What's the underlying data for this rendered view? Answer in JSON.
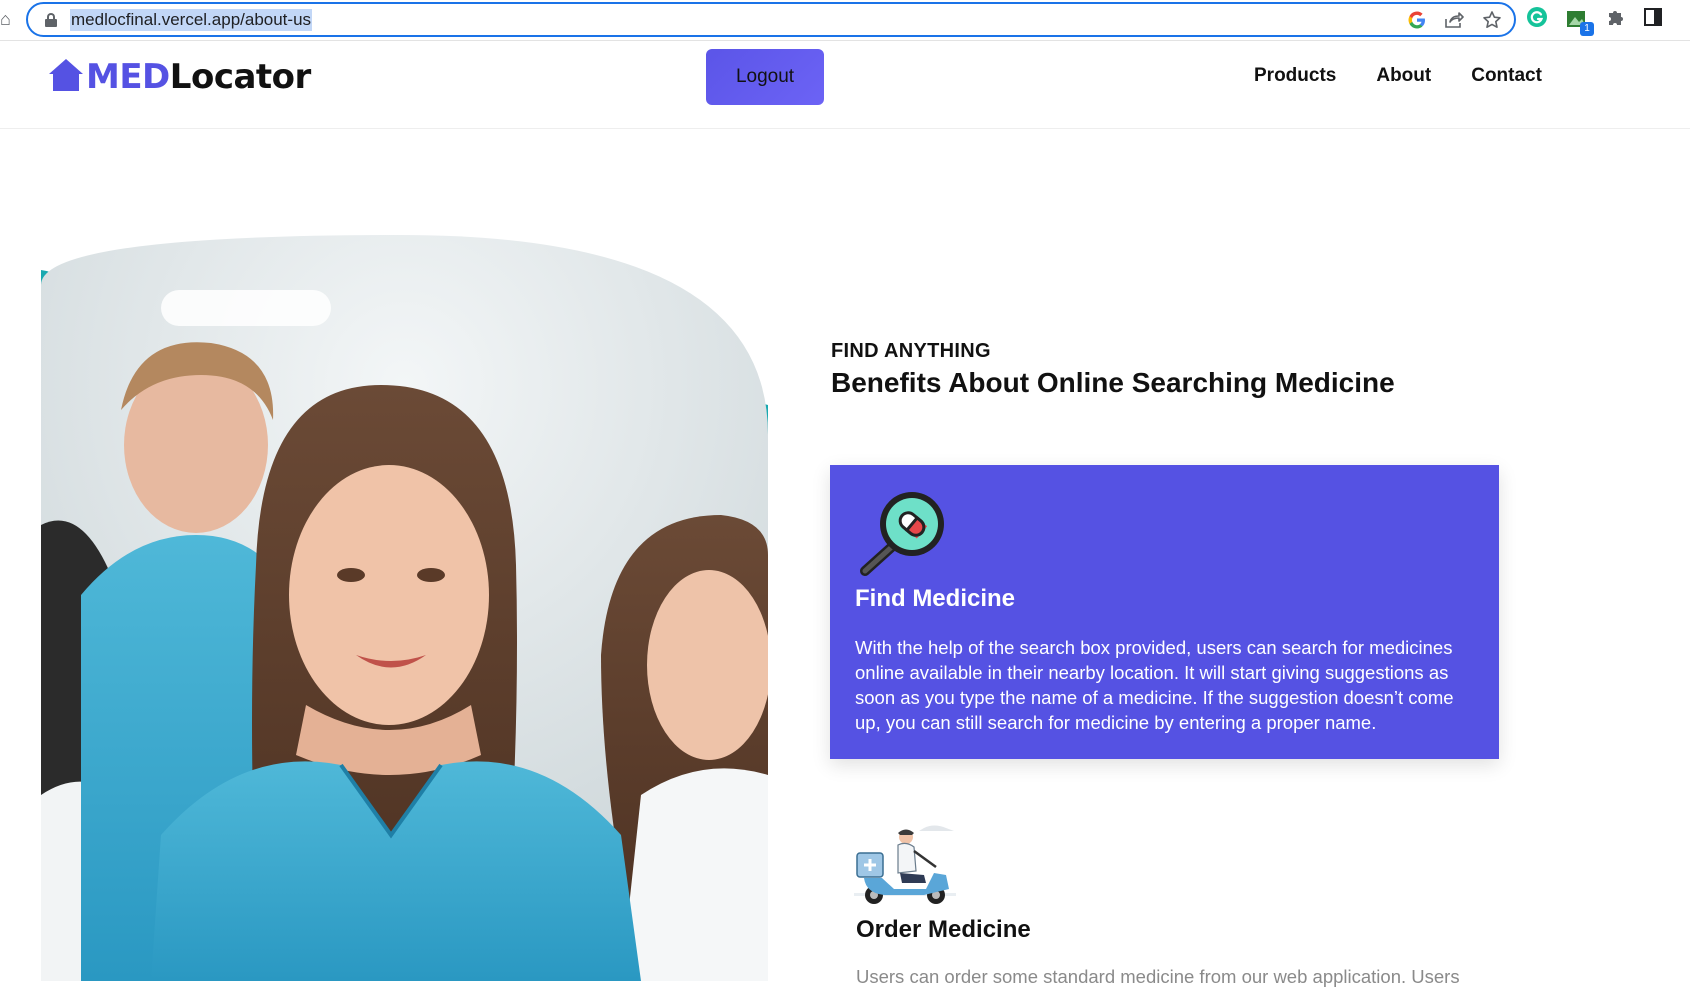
{
  "browser": {
    "url": "medlocfinal.vercel.app/about-us",
    "icons": [
      "home-icon",
      "lock-icon",
      "google-icon",
      "share-icon",
      "star-icon",
      "grammarly-icon",
      "extension-badge-icon",
      "puzzle-icon",
      "side-panel-icon"
    ],
    "extension_badge_count": "1"
  },
  "header": {
    "logo_prefix": "MED",
    "logo_suffix": "Locator",
    "logout_label": "Logout",
    "nav": [
      {
        "label": "Products"
      },
      {
        "label": "About"
      },
      {
        "label": "Contact"
      }
    ]
  },
  "main": {
    "eyebrow": "FIND ANYTHING",
    "title": "Benefits About Online Searching Medicine",
    "features": [
      {
        "icon": "magnifier-pill-icon",
        "title": "Find Medicine",
        "text": "With the help of the search box provided, users can search for medicines online available in their nearby location. It will start giving suggestions as soon as you type the name of a medicine. If the suggestion doesn’t come up, you can still search for medicine by entering a proper name."
      },
      {
        "icon": "delivery-scooter-icon",
        "title": "Order Medicine",
        "text": "Users can order some standard medicine from our web application. Users"
      }
    ]
  },
  "colors": {
    "brand": "#5552e3",
    "nav_text": "#111111",
    "url_highlight": "#c2d7f7",
    "omnibox_border": "#1a73e8"
  }
}
